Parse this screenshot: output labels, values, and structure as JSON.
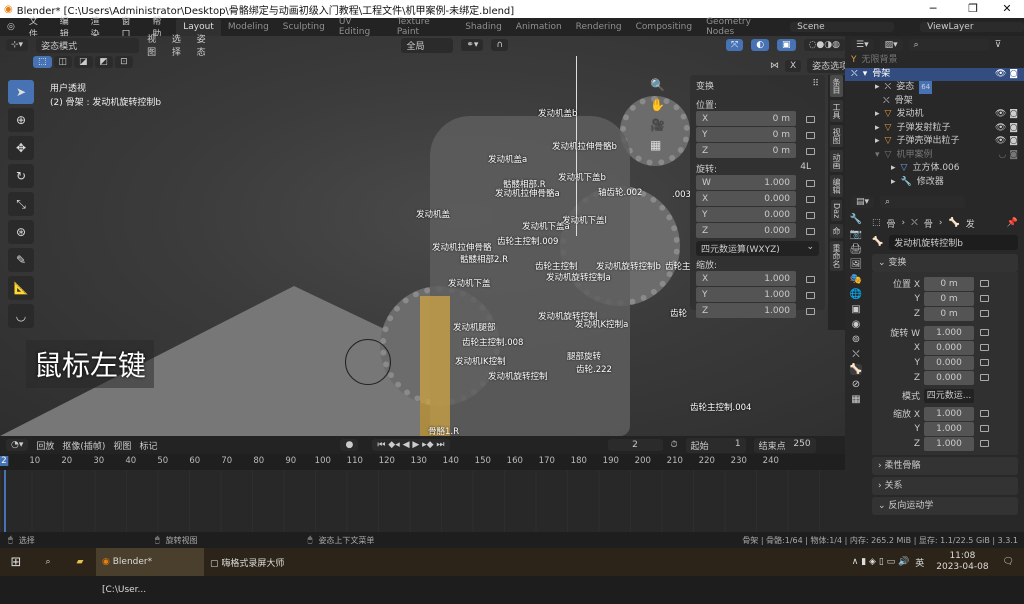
{
  "window": {
    "title": "Blender* [C:\\Users\\Administrator\\Desktop\\骨骼绑定与动画初级入门教程\\工程文件\\机甲案例-未绑定.blend]",
    "minimize": "─",
    "maximize": "❐",
    "close": "✕"
  },
  "menu": {
    "items": [
      "文件",
      "编辑",
      "渲染",
      "窗口",
      "帮助"
    ],
    "workspaces": [
      "Layout",
      "Modeling",
      "Sculpting",
      "UV Editing",
      "Texture Paint",
      "Shading",
      "Animation",
      "Rendering",
      "Compositing",
      "Geometry Nodes"
    ],
    "active_workspace": "Layout",
    "scene": "Scene",
    "view_layer": "ViewLayer"
  },
  "viewport": {
    "mode": "姿态模式",
    "menus": [
      "视图",
      "选择",
      "姿态"
    ],
    "transform_orientation": "全局",
    "pose_options": "姿态选项",
    "axis_x": "X",
    "view_name": "用户透视",
    "active_info": "(2) 骨架 : 发动机旋转控制b",
    "caption": "鼠标左键",
    "bone_labels": [
      "发动机盖b",
      "发动机拉伸骨骼b",
      "发动机盖a",
      "发动机下盖b",
      "骷髅相部.R",
      "发动机拉伸骨骼a",
      "轴齿轮.002",
      "发动机盖",
      "发动机下盖a",
      "发动机下盖l",
      "齿轮主控制.009",
      "发动机拉伸骨骼",
      "骷髅相部2.R",
      "发动机旋转控制b",
      "齿轮主控制",
      "发动机旋转控制a",
      "齿轮主",
      "发动机下盖",
      "发动机旋转控制",
      "发动机腿部",
      "发动机K控制a",
      "齿轮主控制.008",
      "齿轮",
      "腿部旋转",
      "发动机IK控制",
      "发动机旋转控制",
      "齿轮.222",
      "齿轮主控制.004",
      "骨骼1.R",
      ".003"
    ]
  },
  "npanel": {
    "header": "变换",
    "location_label": "位置:",
    "location": [
      {
        "axis": "X",
        "value": "0 m"
      },
      {
        "axis": "Y",
        "value": "0 m"
      },
      {
        "axis": "Z",
        "value": "0 m"
      }
    ],
    "rotation_label": "旋转:",
    "rotation_extra": "4L",
    "rotation": [
      {
        "axis": "W",
        "value": "1.000"
      },
      {
        "axis": "X",
        "value": "0.000"
      },
      {
        "axis": "Y",
        "value": "0.000"
      },
      {
        "axis": "Z",
        "value": "0.000"
      }
    ],
    "rotation_mode": "四元数运算(WXYZ)",
    "scale_label": "缩放:",
    "scale": [
      {
        "axis": "X",
        "value": "1.000"
      },
      {
        "axis": "Y",
        "value": "1.000"
      },
      {
        "axis": "Z",
        "value": "1.000"
      }
    ],
    "tabs": [
      "条目",
      "工具",
      "视图",
      "动画",
      "编辑",
      "Daz",
      "命",
      "重命名"
    ]
  },
  "outliner": {
    "items": [
      {
        "name": "无限背景"
      },
      {
        "name": "骨架",
        "selected": true
      },
      {
        "name": "姿态",
        "badge": "64"
      },
      {
        "name": "骨架"
      },
      {
        "name": "发动机"
      },
      {
        "name": "子弹发射粒子"
      },
      {
        "name": "子弹壳弹出粒子"
      },
      {
        "name": "机甲案例"
      },
      {
        "name": "立方体.006"
      },
      {
        "name": "修改器"
      }
    ]
  },
  "properties": {
    "breadcrumb": [
      "骨",
      "骨",
      "发"
    ],
    "bone_name": "发动机旋转控制b",
    "section": "变换",
    "location": [
      {
        "label": "位置 X",
        "value": "0 m"
      },
      {
        "label": "Y",
        "value": "0 m"
      },
      {
        "label": "Z",
        "value": "0 m"
      }
    ],
    "rotation": [
      {
        "label": "旋转 W",
        "value": "1.000"
      },
      {
        "label": "X",
        "value": "0.000"
      },
      {
        "label": "Y",
        "value": "0.000"
      },
      {
        "label": "Z",
        "value": "0.000"
      }
    ],
    "mode_label": "模式",
    "mode_value": "四元数运...",
    "scale": [
      {
        "label": "缩放 X",
        "value": "1.000"
      },
      {
        "label": "Y",
        "value": "1.000"
      },
      {
        "label": "Z",
        "value": "1.000"
      }
    ],
    "sections": [
      "柔性骨骼",
      "关系",
      "反向运动学"
    ]
  },
  "timeline": {
    "menus": [
      "回放",
      "抠像(插帧)",
      "视图",
      "标记"
    ],
    "current_frame": "2",
    "start_label": "起始",
    "start": "1",
    "end_label": "结束点",
    "end": "250",
    "ticks": [
      "2",
      "10",
      "20",
      "30",
      "40",
      "50",
      "60",
      "70",
      "80",
      "90",
      "100",
      "110",
      "120",
      "130",
      "140",
      "150",
      "160",
      "170",
      "180",
      "190",
      "200",
      "210",
      "220",
      "230",
      "240"
    ]
  },
  "status": {
    "select": "选择",
    "rotate": "旋转视图",
    "context": "姿态上下文菜单",
    "info": "骨架 | 骨骼:1/64 | 物体:1/4 | 内存: 265.2 MiB | 显存: 1.1/22.5 GiB | 3.3.1"
  },
  "taskbar": {
    "blender": "Blender* [C:\\User...",
    "recorder": "嗨格式录屏大师",
    "ime": "英",
    "time": "11:08",
    "date": "2023-04-08"
  },
  "colors": {
    "accent": "#4772b3",
    "selected_row": "#334d80",
    "bone_orange": "#e09b3d"
  }
}
